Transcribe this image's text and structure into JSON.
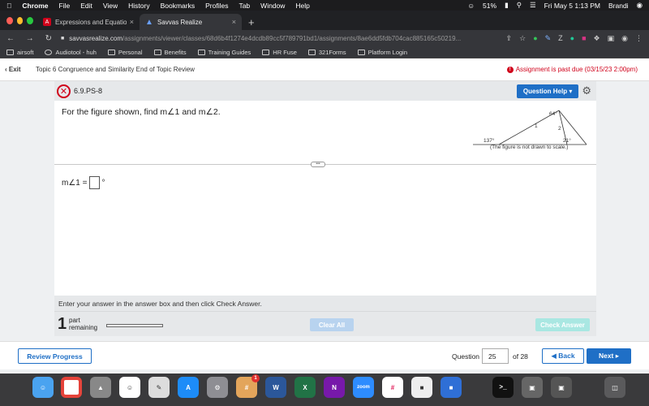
{
  "menubar": {
    "apple": "",
    "app_name": "Chrome",
    "menus": [
      "File",
      "Edit",
      "View",
      "History",
      "Bookmarks",
      "Profiles",
      "Tab",
      "Window",
      "Help"
    ],
    "battery": "51%",
    "datetime": "Fri May 5  1:13 PM",
    "user": "Brandi"
  },
  "tabs": [
    {
      "title": "Expressions and Equations Re",
      "close": "×"
    },
    {
      "title": "Savvas Realize",
      "close": "×"
    }
  ],
  "new_tab": "+",
  "address": {
    "host": "savvasrealize.com",
    "path": "/assignments/viewer/classes/68d6b4f1274e4dcdb89cc5f789791bd1/assignments/8ae6dd5fdb704cac885165c50219..."
  },
  "bookmarks": [
    "airsoft",
    "Audiotool - huh",
    "Personal",
    "Benefits",
    "Training Guides",
    "HR Fuse",
    "321Forms",
    "Platform Login"
  ],
  "topnav": {
    "exit": "Exit",
    "topic": "Topic 6 Congruence and Similarity End of Topic Review",
    "past_due": "Assignment is past due (03/15/23 2:00pm)"
  },
  "question": {
    "id": "6.9.PS-8",
    "help_label": "Question Help",
    "prompt": "For the figure shown, find m∠1 and m∠2.",
    "answer_prefix": "m∠1 =",
    "answer_suffix": "°",
    "instruction": "Enter your answer in the answer box and then click Check Answer.",
    "parts_count": "1",
    "parts_label_1": "part",
    "parts_label_2": "remaining",
    "clear_all": "Clear All",
    "check_answer": "Check Answer"
  },
  "figure": {
    "angle_top": "64°",
    "angle_1": "1",
    "angle_2": "2",
    "angle_exterior": "137°",
    "angle_21": "21°",
    "caption": "(The figure is not drawn to scale.)"
  },
  "footer": {
    "review_progress": "Review Progress",
    "question_label": "Question",
    "current": "25",
    "of_label": "of 28",
    "back": "◀  Back",
    "next": "Next  ▸"
  },
  "dock_badge": "1",
  "colors": {
    "primary": "#1f6fc6",
    "error": "#d0021b",
    "check_disabled": "#a9e7e2",
    "clear_disabled": "#b8d3ef"
  }
}
